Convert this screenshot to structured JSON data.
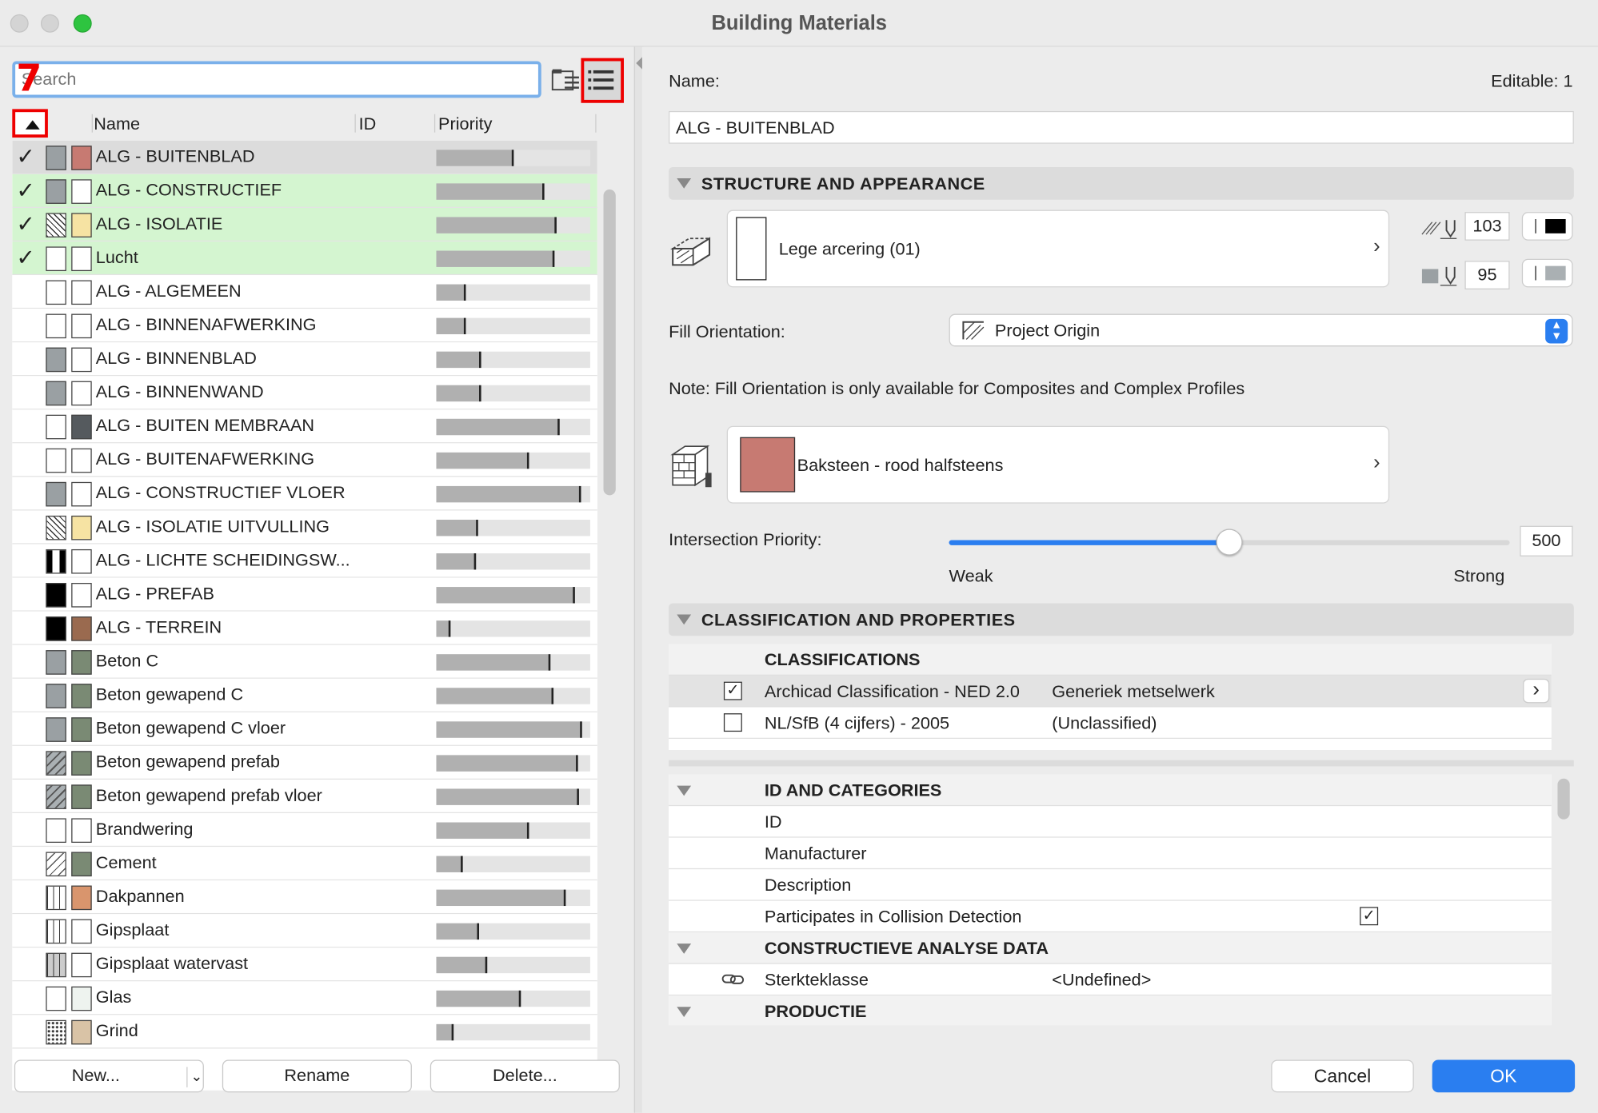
{
  "window": {
    "title": "Building Materials"
  },
  "left": {
    "search_placeholder": "Search",
    "annotation_number": "7",
    "columns": {
      "name": "Name",
      "id": "ID",
      "priority": "Priority"
    },
    "rows": [
      {
        "name": "ALG - BUITENBLAD",
        "check": true,
        "state": "sel",
        "sw1": "#9aa0a3",
        "sw2": "#c77a72",
        "p": 0.5
      },
      {
        "name": "ALG - CONSTRUCTIEF",
        "check": true,
        "state": "used",
        "sw1": "#9aa0a3",
        "sw2": "#ffffff",
        "p": 0.7
      },
      {
        "name": "ALG - ISOLATIE",
        "check": true,
        "state": "used",
        "sw1": "pattern-cross",
        "sw2": "#f6e3a3",
        "p": 0.78
      },
      {
        "name": "Lucht",
        "check": true,
        "state": "used",
        "sw1": "#ffffff",
        "sw2": "#ffffff",
        "p": 0.77
      },
      {
        "name": "ALG - ALGEMEEN",
        "check": false,
        "state": "",
        "sw1": "#ffffff",
        "sw2": "#ffffff",
        "p": 0.19
      },
      {
        "name": "ALG - BINNENAFWERKING",
        "check": false,
        "state": "",
        "sw1": "#ffffff",
        "sw2": "#ffffff",
        "p": 0.19
      },
      {
        "name": "ALG - BINNENBLAD",
        "check": false,
        "state": "",
        "sw1": "#9aa0a3",
        "sw2": "#ffffff",
        "p": 0.29
      },
      {
        "name": "ALG - BINNENWAND",
        "check": false,
        "state": "",
        "sw1": "#9aa0a3",
        "sw2": "#ffffff",
        "p": 0.29
      },
      {
        "name": "ALG - BUITEN MEMBRAAN",
        "check": false,
        "state": "",
        "sw1": "#ffffff",
        "sw2": "#555a5e",
        "p": 0.8
      },
      {
        "name": "ALG - BUITENAFWERKING",
        "check": false,
        "state": "",
        "sw1": "#ffffff",
        "sw2": "#ffffff",
        "p": 0.6
      },
      {
        "name": "ALG - CONSTRUCTIEF VLOER",
        "check": false,
        "state": "",
        "sw1": "#9aa0a3",
        "sw2": "#ffffff",
        "p": 0.94
      },
      {
        "name": "ALG - ISOLATIE UITVULLING",
        "check": false,
        "state": "",
        "sw1": "pattern-cross",
        "sw2": "#f6e3a3",
        "p": 0.27
      },
      {
        "name": "ALG - LICHTE SCHEIDINGSW...",
        "check": false,
        "state": "",
        "sw1": "pattern-bars",
        "sw2": "#ffffff",
        "p": 0.26
      },
      {
        "name": "ALG - PREFAB",
        "check": false,
        "state": "",
        "sw1": "#000000",
        "sw2": "#ffffff",
        "p": 0.9
      },
      {
        "name": "ALG - TERREIN",
        "check": false,
        "state": "",
        "sw1": "#000000",
        "sw2": "#9a6a4f",
        "p": 0.09
      },
      {
        "name": "Beton C",
        "check": false,
        "state": "",
        "sw1": "#9aa0a3",
        "sw2": "#7a8a74",
        "p": 0.74
      },
      {
        "name": "Beton gewapend C",
        "check": false,
        "state": "",
        "sw1": "#9aa0a3",
        "sw2": "#7a8a74",
        "p": 0.76
      },
      {
        "name": "Beton gewapend C vloer",
        "check": false,
        "state": "",
        "sw1": "#9aa0a3",
        "sw2": "#7a8a74",
        "p": 0.95
      },
      {
        "name": "Beton gewapend prefab",
        "check": false,
        "state": "",
        "sw1": "pattern-diag",
        "sw2": "#7a8a74",
        "p": 0.92
      },
      {
        "name": "Beton gewapend prefab vloer",
        "check": false,
        "state": "",
        "sw1": "pattern-diag",
        "sw2": "#7a8a74",
        "p": 0.93
      },
      {
        "name": "Brandwering",
        "check": false,
        "state": "",
        "sw1": "#ffffff",
        "sw2": "#ffffff",
        "p": 0.6
      },
      {
        "name": "Cement",
        "check": false,
        "state": "",
        "sw1": "pattern-wave",
        "sw2": "#7a8a74",
        "p": 0.17
      },
      {
        "name": "Dakpannen",
        "check": false,
        "state": "",
        "sw1": "pattern-vlines",
        "sw2": "#d9956d",
        "p": 0.84
      },
      {
        "name": "Gipsplaat",
        "check": false,
        "state": "",
        "sw1": "pattern-vlines",
        "sw2": "#ffffff",
        "p": 0.28
      },
      {
        "name": "Gipsplaat watervast",
        "check": false,
        "state": "",
        "sw1": "pattern-vlines-grey",
        "sw2": "#ffffff",
        "p": 0.33
      },
      {
        "name": "Glas",
        "check": false,
        "state": "",
        "sw1": "#ffffff",
        "sw2": "#eef3ef",
        "p": 0.55
      },
      {
        "name": "Grind",
        "check": false,
        "state": "",
        "sw1": "pattern-dots",
        "sw2": "#d9c3a6",
        "p": 0.11
      }
    ],
    "buttons": {
      "new": "New...",
      "rename": "Rename",
      "delete": "Delete..."
    }
  },
  "right": {
    "name_label": "Name:",
    "editable_label": "Editable: 1",
    "name_value": "ALG - BUITENBLAD",
    "section_structure": "STRUCTURE AND APPEARANCE",
    "cut_fill": "Lege arcering (01)",
    "pen_fg": "103",
    "pen_bg": "95",
    "fill_orientation_label": "Fill Orientation:",
    "fill_orientation_value": "Project Origin",
    "note": "Note: Fill Orientation is only available for Composites and Complex Profiles",
    "surface": "Baksteen - rood halfsteens",
    "surface_color": "#c77a72",
    "intersection_label": "Intersection Priority:",
    "intersection_value": "500",
    "intersection_fraction": 0.5,
    "weak": "Weak",
    "strong": "Strong",
    "section_classification": "CLASSIFICATION AND PROPERTIES",
    "classifications_header": "CLASSIFICATIONS",
    "classifications": [
      {
        "system": "Archicad Classification - NED 2.0",
        "value": "Generiek metselwerk",
        "checked": true
      },
      {
        "system": "NL/SfB (4 cijfers) - 2005",
        "value": "(Unclassified)",
        "checked": false
      }
    ],
    "id_header": "ID AND CATEGORIES",
    "id_rows": [
      "ID",
      "Manufacturer",
      "Description",
      "Participates in Collision Detection"
    ],
    "analysis_header": "CONSTRUCTIEVE ANALYSE DATA",
    "analysis_row": {
      "name": "Sterkteklasse",
      "value": "<Undefined>"
    },
    "productie_header": "PRODUCTIE",
    "cancel": "Cancel",
    "ok": "OK"
  }
}
